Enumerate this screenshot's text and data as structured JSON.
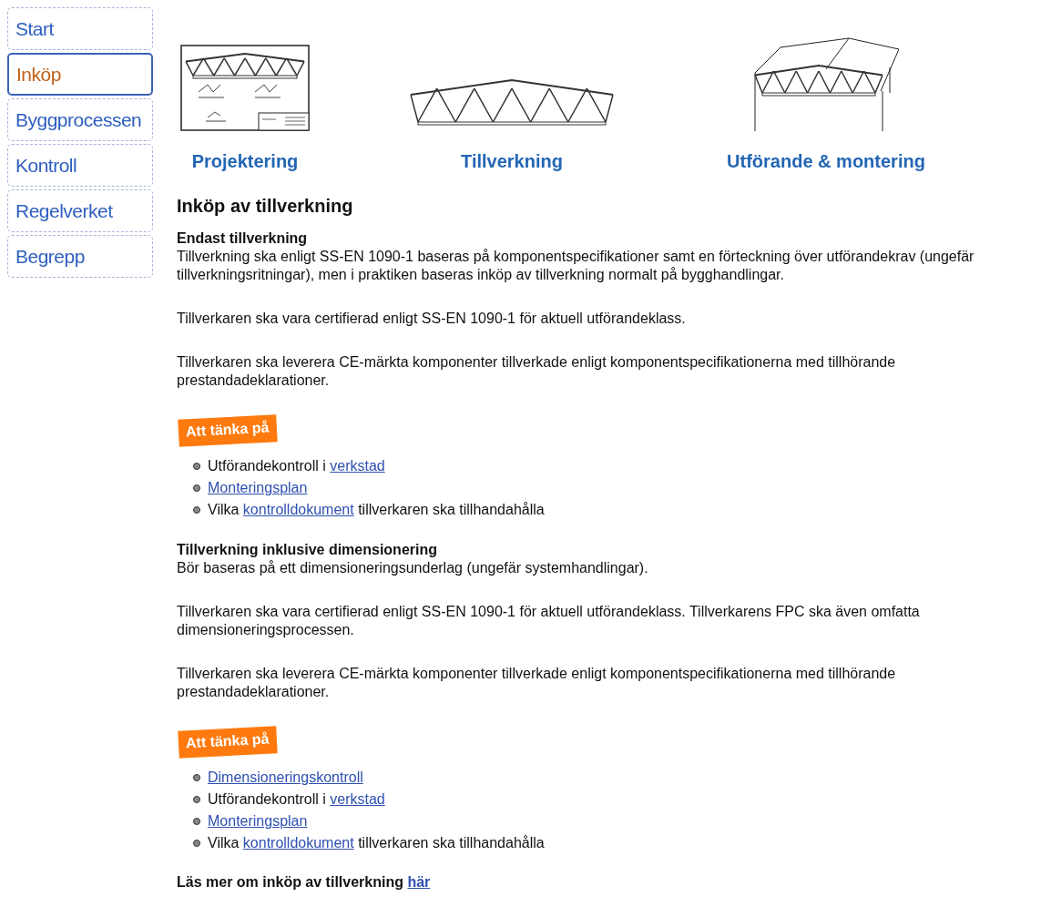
{
  "nav": [
    {
      "label": "Start",
      "selected": false
    },
    {
      "label": "Inköp",
      "selected": true
    },
    {
      "label": "Byggprocessen",
      "selected": false
    },
    {
      "label": "Kontroll",
      "selected": false
    },
    {
      "label": "Regelverket",
      "selected": false
    },
    {
      "label": "Begrepp",
      "selected": false
    }
  ],
  "phases": [
    {
      "kind": "drawing",
      "label": "Projektering"
    },
    {
      "kind": "truss",
      "label": "Tillverkning"
    },
    {
      "kind": "building",
      "label": "Utförande & montering"
    }
  ],
  "title": "Inköp av tillverkning",
  "blocks": [
    {
      "kind": "subheading",
      "text": "Endast tillverkning"
    },
    {
      "kind": "paragraph",
      "text": "Tillverkning ska enligt SS-EN 1090-1 baseras på komponentspecifikationer samt en förteckning över utförandekrav (ungefär tillverkningsritningar), men i praktiken baseras inköp av tillverkning normalt på bygghandlingar."
    },
    {
      "kind": "paragraph",
      "text": "Tillverkaren ska vara certifierad enligt SS-EN 1090-1 för aktuell utförandeklass."
    },
    {
      "kind": "paragraph",
      "text": "Tillverkaren ska leverera CE-märkta komponenter tillverkade enligt komponentspecifikationerna med tillhörande prestandadeklarationer."
    },
    {
      "kind": "tag",
      "text": "Att tänka på"
    },
    {
      "kind": "list",
      "items": [
        [
          {
            "text": "Utförandekontroll i ",
            "link": false
          },
          {
            "text": "verkstad",
            "link": true
          }
        ],
        [
          {
            "text": "Monteringsplan",
            "link": true
          }
        ],
        [
          {
            "text": "Vilka ",
            "link": false
          },
          {
            "text": "kontrolldokument",
            "link": true
          },
          {
            "text": " tillverkaren ska tillhandahålla",
            "link": false
          }
        ]
      ]
    },
    {
      "kind": "subheading",
      "text": "Tillverkning inklusive dimensionering"
    },
    {
      "kind": "paragraph",
      "text": "Bör baseras på ett dimensioneringsunderlag (ungefär systemhandlingar)."
    },
    {
      "kind": "paragraph",
      "text": "Tillverkaren ska vara certifierad enligt SS-EN 1090-1 för aktuell utförandeklass. Tillverkarens FPC ska även omfatta dimensioneringsprocessen."
    },
    {
      "kind": "paragraph",
      "text": "Tillverkaren ska leverera CE-märkta komponenter tillverkade enligt komponentspecifikationerna med tillhörande prestandadeklarationer."
    },
    {
      "kind": "tag",
      "text": "Att tänka på"
    },
    {
      "kind": "list",
      "items": [
        [
          {
            "text": "Dimensioneringskontroll",
            "link": true
          }
        ],
        [
          {
            "text": "Utförandekontroll i ",
            "link": false
          },
          {
            "text": "verkstad",
            "link": true
          }
        ],
        [
          {
            "text": "Monteringsplan",
            "link": true
          }
        ],
        [
          {
            "text": "Vilka ",
            "link": false
          },
          {
            "text": "kontrolldokument",
            "link": true
          },
          {
            "text": " tillverkaren ska tillhandahålla",
            "link": false
          }
        ]
      ]
    },
    {
      "kind": "more",
      "segments": [
        {
          "text": "Läs mer om inköp av tillverkning ",
          "link": false
        },
        {
          "text": "här",
          "link": true
        }
      ]
    }
  ]
}
